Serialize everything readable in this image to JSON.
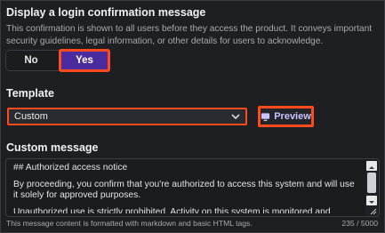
{
  "login_message": {
    "title": "Display a login confirmation message",
    "description": "This confirmation is shown to all users before they access the product. It conveys important security guidelines, legal information, or other details for users to acknowledge.",
    "toggle": {
      "no_label": "No",
      "yes_label": "Yes",
      "selected": "Yes"
    }
  },
  "template": {
    "label": "Template",
    "selected": "Custom",
    "preview_label": "Preview"
  },
  "custom_message": {
    "label": "Custom message",
    "lines": [
      "## Authorized access notice",
      "By proceeding, you confirm that you're authorized to access this system and will use it solely for approved purposes.",
      "Unauthorized use is strictly prohibited. Activity on this system is monitored and logged."
    ],
    "hint": "This message content is formatted with markdown and basic HTML tags.",
    "counter": "235 / 5000"
  },
  "colors": {
    "highlight": "#ff4a1c",
    "accent": "#4b2c9e",
    "background": "#1e1f23"
  }
}
